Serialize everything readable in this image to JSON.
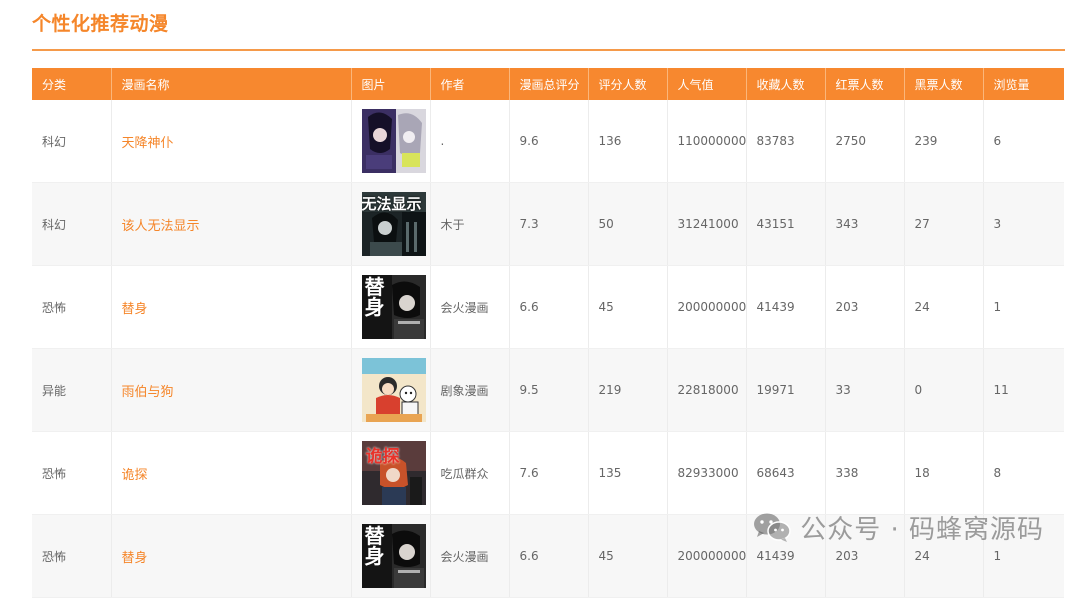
{
  "page": {
    "title": "个性化推荐动漫"
  },
  "table": {
    "headers": [
      "分类",
      "漫画名称",
      "图片",
      "作者",
      "漫画总评分",
      "评分人数",
      "人气值",
      "收藏人数",
      "红票人数",
      "黑票人数",
      "浏览量"
    ],
    "rows": [
      {
        "category": "科幻",
        "name": "天降神仆",
        "cover": "cover-1",
        "author": ".",
        "score": "9.6",
        "raters": "136",
        "popularity": "110000000",
        "favorites": "83783",
        "red_votes": "2750",
        "black_votes": "239",
        "views": "6"
      },
      {
        "category": "科幻",
        "name": "该人无法显示",
        "cover": "cover-2",
        "cover_text": "无法显示",
        "author": "木于",
        "score": "7.3",
        "raters": "50",
        "popularity": "31241000",
        "favorites": "43151",
        "red_votes": "343",
        "black_votes": "27",
        "views": "3"
      },
      {
        "category": "恐怖",
        "name": "替身",
        "cover": "cover-3",
        "cover_text": "替身",
        "author": "会火漫画",
        "score": "6.6",
        "raters": "45",
        "popularity": "200000000",
        "favorites": "41439",
        "red_votes": "203",
        "black_votes": "24",
        "views": "1"
      },
      {
        "category": "异能",
        "name": "雨伯与狗",
        "cover": "cover-4",
        "author": "剧象漫画",
        "score": "9.5",
        "raters": "219",
        "popularity": "22818000",
        "favorites": "19971",
        "red_votes": "33",
        "black_votes": "0",
        "views": "11"
      },
      {
        "category": "恐怖",
        "name": "诡探",
        "cover": "cover-5",
        "cover_text": "诡探",
        "author": "吃瓜群众",
        "score": "7.6",
        "raters": "135",
        "popularity": "82933000",
        "favorites": "68643",
        "red_votes": "338",
        "black_votes": "18",
        "views": "8"
      },
      {
        "category": "恐怖",
        "name": "替身",
        "cover": "cover-3",
        "cover_text": "替身",
        "author": "会火漫画",
        "score": "6.6",
        "raters": "45",
        "popularity": "200000000",
        "favorites": "41439",
        "red_votes": "203",
        "black_votes": "24",
        "views": "1"
      }
    ]
  },
  "watermark": {
    "icon": "wechat-icon",
    "text": "公众号 · 码蜂窝源码"
  },
  "colors": {
    "accent": "#f7882f",
    "title": "#f5862a",
    "link": "#f5862a"
  }
}
